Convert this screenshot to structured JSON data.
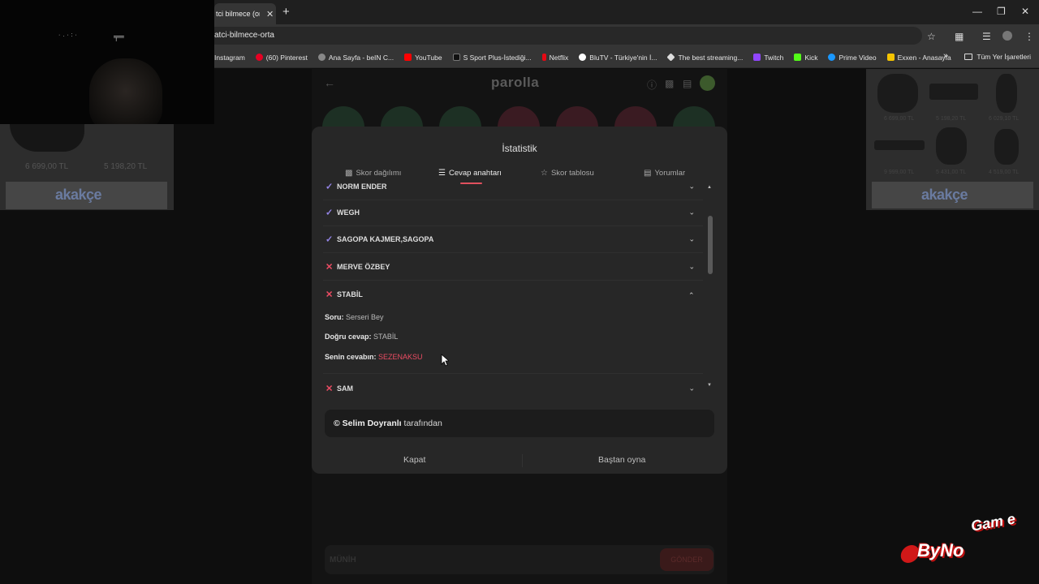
{
  "browser": {
    "tab_title": "tci bilmece (ort",
    "url": "atci-bilmece-orta",
    "bookmarks": [
      {
        "label": "Instagram",
        "color": "#e1306c"
      },
      {
        "label": "(60) Pinterest",
        "color": "#e60023"
      },
      {
        "label": "Ana Sayfa - beIN C...",
        "color": "#888888"
      },
      {
        "label": "YouTube",
        "color": "#ff0000"
      },
      {
        "label": "S Sport Plus-İstediği...",
        "color": "#222222"
      },
      {
        "label": "Netflix",
        "color": "#e50914"
      },
      {
        "label": "BluTV - Türkiye'nin İ...",
        "color": "#2b6cff"
      },
      {
        "label": "The best streaming...",
        "color": "#dddddd"
      },
      {
        "label": "Twitch",
        "color": "#9146ff"
      },
      {
        "label": "Kick",
        "color": "#53fc18"
      },
      {
        "label": "Prime Video",
        "color": "#1a98ff"
      },
      {
        "label": "Exxen - Anasayfa",
        "color": "#f5c400"
      }
    ],
    "all_bookmarks": "Tüm Yer İşaretleri"
  },
  "ad_left": {
    "price1": "6 699,00 TL",
    "price2": "5 198,20 TL",
    "brand": "akakçe"
  },
  "ad_right": {
    "prices": [
      "6 699,00 TL",
      "5 198,20 TL",
      "6 029,10 TL",
      "9 999,00 TL",
      "5 431,00 TL",
      "4 519,00 TL"
    ],
    "brand": "akakçe"
  },
  "page": {
    "brand": "parolla",
    "answer_placeholder": "MÜNİH",
    "answer_button": "GÖNDER"
  },
  "modal": {
    "title": "İstatistik",
    "tabs": [
      "Skor dağılımı",
      "Cevap anahtarı",
      "Skor tablosu",
      "Yorumlar"
    ],
    "rows": [
      {
        "word": "NORM ENDER",
        "status": "correct"
      },
      {
        "word": "WEGH",
        "status": "correct"
      },
      {
        "word": "SAGOPA KAJMER,SAGOPA",
        "status": "correct"
      },
      {
        "word": "MERVE ÖZBEY",
        "status": "wrong"
      },
      {
        "word": "STABİL",
        "status": "wrong"
      },
      {
        "word": "SAM",
        "status": "wrong"
      }
    ],
    "detail": {
      "question_label": "Soru:",
      "question": "Serseri Bey",
      "correct_label": "Doğru cevap:",
      "correct": "STABİL",
      "your_label": "Senin cevabın:",
      "your": "SEZENAKSU"
    },
    "credit_name": "© Selim Doyranlı",
    "credit_suffix": " tarafından",
    "close_label": "Kapat",
    "restart_label": "Baştan oyna"
  },
  "watermark": {
    "text1": "ByNo",
    "text2": "Gam e"
  },
  "colors": {
    "correct": "#9585e8",
    "wrong": "#ec4c63",
    "accent": "#e0505e"
  }
}
